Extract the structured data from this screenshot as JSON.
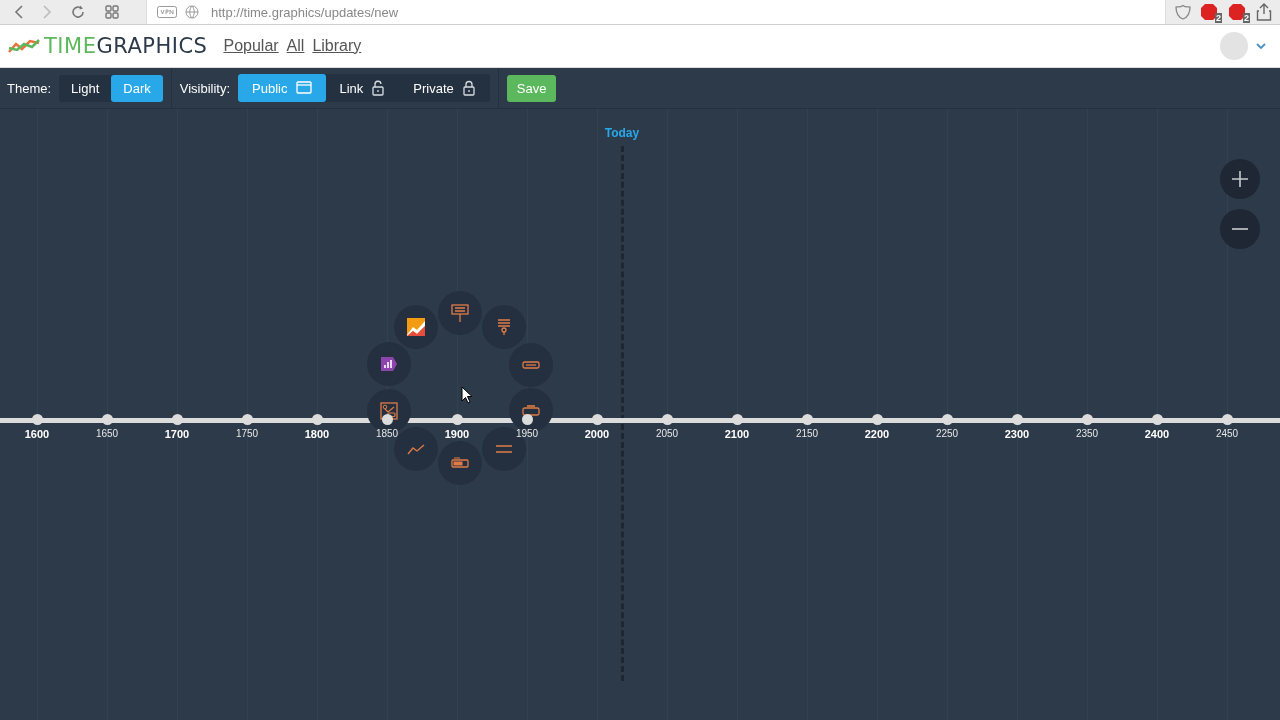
{
  "browser": {
    "url": "http://time.graphics/updates/new",
    "extension_badges": [
      "2",
      "2"
    ]
  },
  "header": {
    "logo": {
      "part_1": "TIME",
      "part_2": "GRAPHICS"
    },
    "nav": [
      "Popular",
      "All",
      "Library"
    ]
  },
  "toolbar": {
    "theme_label": "Theme:",
    "themes": [
      {
        "label": "Light",
        "selected": false
      },
      {
        "label": "Dark",
        "selected": true
      }
    ],
    "visibility_label": "Visibility:",
    "visibility": [
      {
        "label": "Public",
        "kind": "public",
        "selected": true
      },
      {
        "label": "Link",
        "kind": "link",
        "selected": false
      },
      {
        "label": "Private",
        "kind": "private",
        "selected": false
      }
    ],
    "save": "Save"
  },
  "timeline": {
    "today_label": "Today",
    "ticks": [
      {
        "label": "1600",
        "major": true
      },
      {
        "label": "1650",
        "major": false
      },
      {
        "label": "1700",
        "major": true
      },
      {
        "label": "1750",
        "major": false
      },
      {
        "label": "1800",
        "major": true
      },
      {
        "label": "1850",
        "major": false
      },
      {
        "label": "1900",
        "major": true
      },
      {
        "label": "1950",
        "major": false
      },
      {
        "label": "2000",
        "major": true
      },
      {
        "label": "2050",
        "major": false
      },
      {
        "label": "2100",
        "major": true
      },
      {
        "label": "2150",
        "major": false
      },
      {
        "label": "2200",
        "major": true
      },
      {
        "label": "2250",
        "major": false
      },
      {
        "label": "2300",
        "major": true
      },
      {
        "label": "2350",
        "major": false
      },
      {
        "label": "2400",
        "major": true
      },
      {
        "label": "2450",
        "major": false
      }
    ]
  }
}
